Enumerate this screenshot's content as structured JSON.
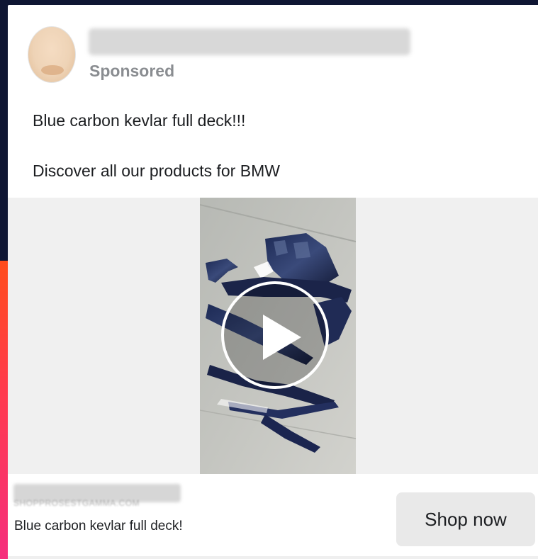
{
  "ad": {
    "sponsored_label": "Sponsored",
    "body_lines": [
      "Blue carbon kevlar full deck!!!",
      "Discover all our products for BMW"
    ],
    "link": {
      "domain": "SHOPPROSESTGAMMA.COM",
      "headline": "Blue carbon kevlar full deck!"
    },
    "cta_label": "Shop now",
    "video": {
      "play_icon": "play-icon"
    }
  },
  "colors": {
    "page_background": "#0f1633",
    "card_background": "#ffffff",
    "media_background": "#f0f0f0",
    "cta_background": "#e9e9e9",
    "secondary_text": "#8a8d91",
    "accent_stripe": "#ff3a4f"
  }
}
